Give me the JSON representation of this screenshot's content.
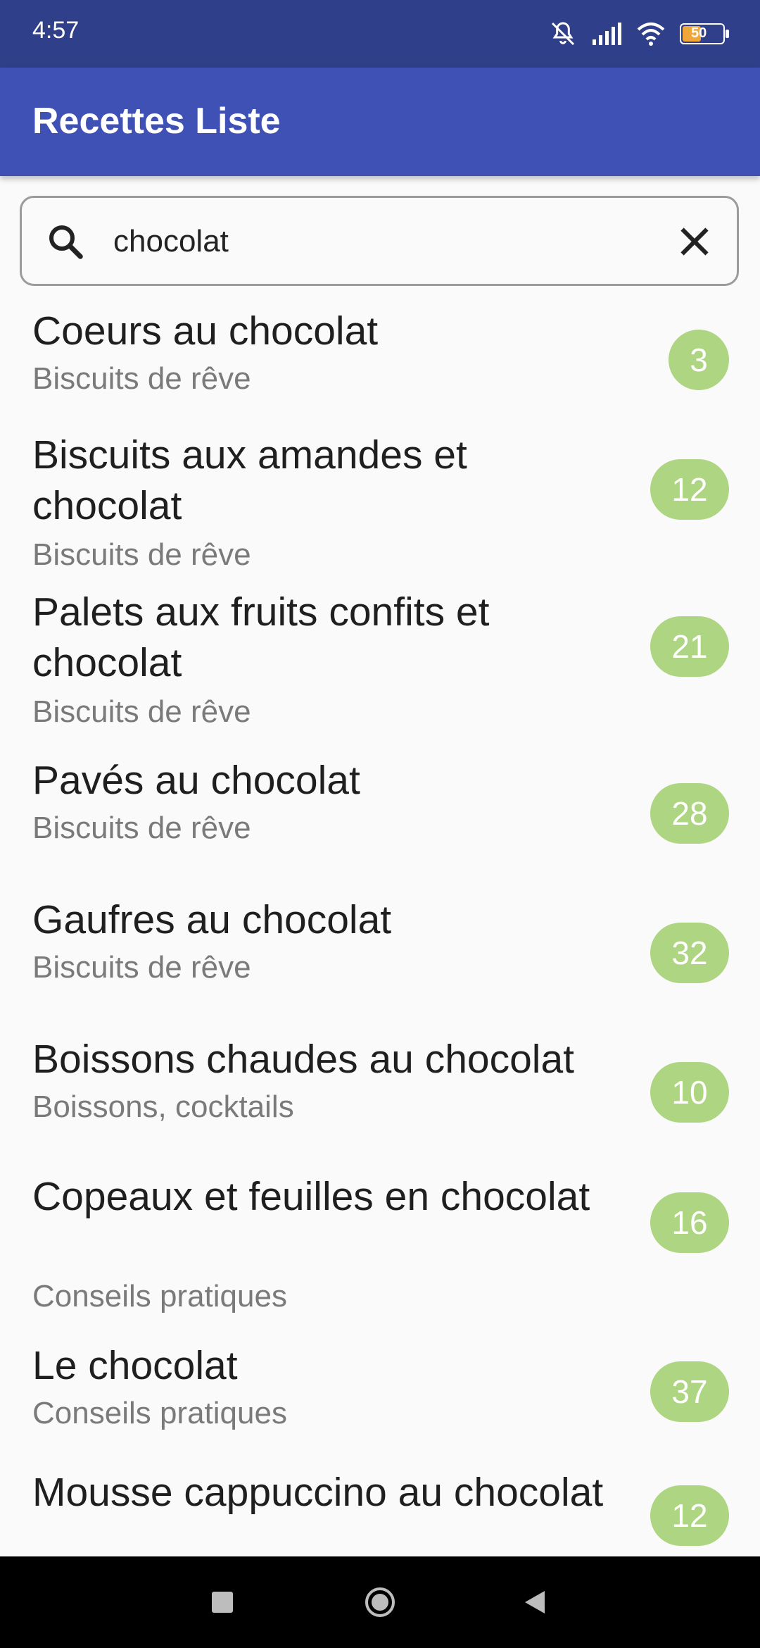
{
  "status_bar": {
    "time": "4:57",
    "battery": "50",
    "icons": [
      "mute-icon",
      "signal-icon",
      "wifi-icon",
      "battery-icon"
    ]
  },
  "app_bar": {
    "title": "Recettes Liste"
  },
  "search": {
    "value": "chocolat",
    "placeholder": ""
  },
  "colors": {
    "status_bar": "#303f89",
    "app_bar": "#3f51b5",
    "badge": "#aed581"
  },
  "recipes": [
    {
      "title": "Coeurs au chocolat",
      "category": "Biscuits de rêve",
      "count": "3"
    },
    {
      "title": "Biscuits aux amandes et chocolat",
      "category": "Biscuits de rêve",
      "count": "12"
    },
    {
      "title": "Palets aux fruits confits et chocolat",
      "category": "Biscuits de rêve",
      "count": "21"
    },
    {
      "title": "Pavés au chocolat",
      "category": "Biscuits de rêve",
      "count": "28"
    },
    {
      "title": "Gaufres au chocolat",
      "category": "Biscuits de rêve",
      "count": "32"
    },
    {
      "title": "Boissons chaudes au chocolat",
      "category": "Boissons, cocktails",
      "count": "10"
    },
    {
      "title": "Copeaux et feuilles en chocolat",
      "category": "Conseils pratiques",
      "count": "16"
    },
    {
      "title": "Le chocolat",
      "category": "Conseils pratiques",
      "count": "37"
    },
    {
      "title": "Mousse cappuccino au chocolat",
      "category": "",
      "count": "12"
    }
  ],
  "nav_bar": {
    "icons": [
      "recents-icon",
      "home-icon",
      "back-icon"
    ]
  }
}
